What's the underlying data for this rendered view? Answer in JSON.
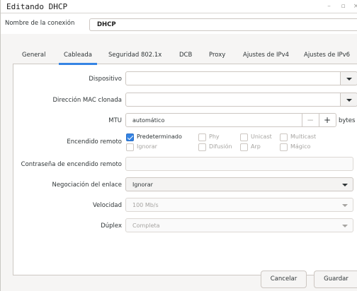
{
  "window": {
    "title": "Editando DHCP"
  },
  "connection": {
    "label": "Nombre de la conexión",
    "value": "DHCP"
  },
  "tabs": [
    {
      "label": "General"
    },
    {
      "label": "Cableada",
      "selected": true
    },
    {
      "label": "Seguridad 802.1x"
    },
    {
      "label": "DCB"
    },
    {
      "label": "Proxy"
    },
    {
      "label": "Ajustes de IPv4"
    },
    {
      "label": "Ajustes de IPv6"
    }
  ],
  "form": {
    "device": {
      "label": "Dispositivo",
      "value": ""
    },
    "cloned_mac": {
      "label": "Dirección MAC clonada",
      "value": ""
    },
    "mtu": {
      "label": "MTU",
      "value": "automático",
      "unit": "bytes",
      "minus": "−",
      "plus": "+"
    },
    "wol": {
      "label": "Encendido remoto",
      "options": [
        {
          "label": "Predeterminado",
          "checked": true
        },
        {
          "label": "Phy",
          "checked": false
        },
        {
          "label": "Unicast",
          "checked": false
        },
        {
          "label": "Multicast",
          "checked": false
        },
        {
          "label": "Ignorar",
          "checked": false
        },
        {
          "label": "Difusión",
          "checked": false
        },
        {
          "label": "Arp",
          "checked": false
        },
        {
          "label": "Mágico",
          "checked": false
        }
      ]
    },
    "wol_password": {
      "label": "Contraseña de encendido remoto",
      "value": ""
    },
    "link_negotiation": {
      "label": "Negociación del enlace",
      "value": "Ignorar"
    },
    "speed": {
      "label": "Velocidad",
      "value": "100 Mb/s"
    },
    "duplex": {
      "label": "Dúplex",
      "value": "Completa"
    }
  },
  "buttons": {
    "cancel": "Cancelar",
    "save": "Guardar"
  },
  "colors": {
    "accent": "#3584e4",
    "window_bg": "#f6f5f4",
    "border": "#cdc7c2"
  }
}
